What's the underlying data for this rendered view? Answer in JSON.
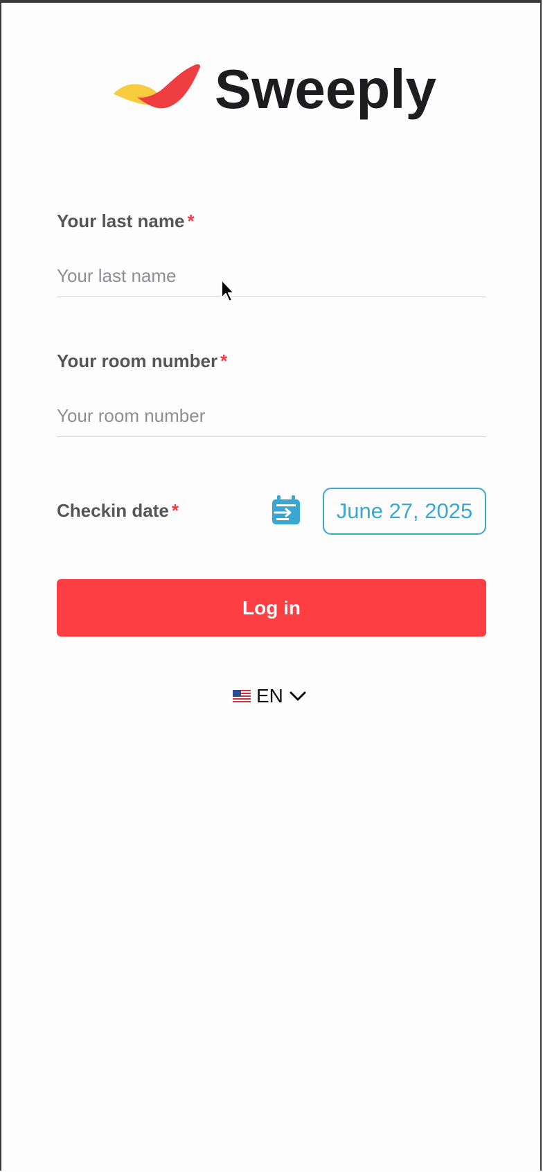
{
  "brand": {
    "name": "Sweeply",
    "colors": {
      "red": "#ef3e42",
      "yellow": "#f5cd3f",
      "text": "#1d1d1f"
    }
  },
  "form": {
    "last_name": {
      "label": "Your last name",
      "required_mark": "*",
      "placeholder": "Your last name",
      "value": ""
    },
    "room_number": {
      "label": "Your room number",
      "required_mark": "*",
      "placeholder": "Your room number",
      "value": ""
    },
    "checkin_date": {
      "label": "Checkin date",
      "required_mark": "*",
      "icon": "calendar-checkin-icon",
      "value": "June 27, 2025"
    },
    "submit_label": "Log in"
  },
  "language": {
    "flag": "us-flag-icon",
    "code": "EN",
    "chevron": "chevron-down-icon"
  },
  "colors": {
    "accent_red": "#fd3e43",
    "accent_blue": "#3aa7d3",
    "label_gray": "#555555",
    "placeholder_gray": "#8e8e93"
  }
}
